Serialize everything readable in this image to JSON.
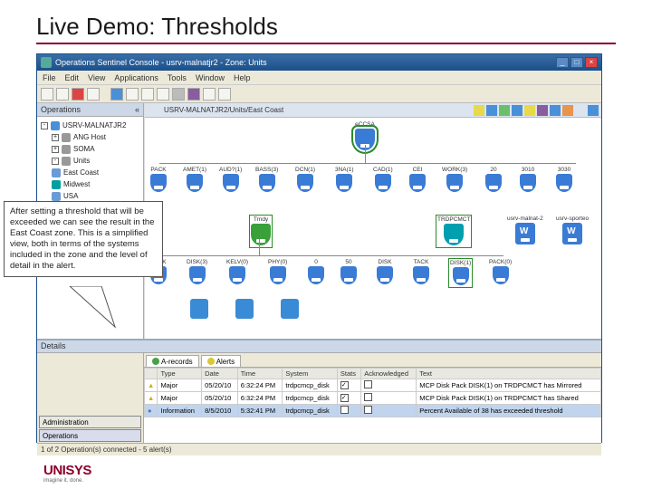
{
  "slide": {
    "title": "Live Demo: Thresholds"
  },
  "callout_text": "After setting a threshold that will be exceeded we can see the result in the East Coast zone.  This is a simplified view, both in terms of the systems included in the zone and the level of detail in the alert.",
  "window": {
    "title": "Operations Sentinel Console - usrv-malnatjr2 - Zone: Units",
    "menu": [
      "File",
      "Edit",
      "View",
      "Applications",
      "Tools",
      "Window",
      "Help"
    ]
  },
  "left_panel": {
    "title": "Operations"
  },
  "tree": [
    {
      "label": "USRV-MALNATJR2",
      "depth": 0,
      "icon": "host",
      "sq": "-"
    },
    {
      "label": "ANG Host",
      "depth": 1,
      "icon": "grp",
      "sq": "+"
    },
    {
      "label": "SOMA",
      "depth": 1,
      "icon": "grp",
      "sq": "+"
    },
    {
      "label": "Units",
      "depth": 1,
      "icon": "grp",
      "sq": "-"
    },
    {
      "label": "East Coast",
      "depth": 1,
      "icon": "globe",
      "sq": ""
    },
    {
      "label": "Midwest",
      "depth": 1,
      "icon": "mach",
      "sq": ""
    },
    {
      "label": "USA",
      "depth": 1,
      "icon": "globe",
      "sq": ""
    }
  ],
  "crumb": "USRV-MALNATJR2/Units/East Coast",
  "top_nodes": {
    "root": "eCCSA",
    "row": [
      "PACK",
      "AMET(1)",
      "AUD?(1)",
      "BASS(3)",
      "DCN(1)",
      "3NA(1)",
      "CAD(1)",
      "CEI",
      "WORK(3)",
      "20",
      "3010",
      "3030"
    ]
  },
  "mid_nodes": {
    "left": "Trndy",
    "right_group": [
      "TRDPCMCT",
      "usrv-malnat-2",
      "usrv-sporteo"
    ]
  },
  "low_nodes": [
    "PACK",
    "DISK(3)",
    "KELV(0)",
    "PHY(0)",
    "0",
    "50",
    "DISK",
    "TACK",
    "DISK(1)",
    "PACK(0)"
  ],
  "details_title": "Details",
  "tabs": [
    "A-records",
    "Alerts"
  ],
  "table": {
    "columns": [
      "",
      "Type",
      "Date",
      "Time",
      "System",
      "Stats",
      "Acknowledged",
      "Text"
    ],
    "rows": [
      [
        "y",
        "Major",
        "05/20/10",
        "6:32:24 PM",
        "trdpcmcp_disk",
        "ck",
        "",
        "MCP Disk Pack DISK(1) on TRDPCMCT has Mirrored"
      ],
      [
        "y",
        "Major",
        "05/20/10",
        "6:32:24 PM",
        "trdpcmcp_disk",
        "ck",
        "",
        "MCP Disk Pack DISK(1) on TRDPCMCT has Shared"
      ],
      [
        "hl",
        "Information",
        "8/5/2010",
        "5:32:41 PM",
        "trdpcmcp_disk",
        "",
        "",
        "Percent Available of 38 has exceeded threshold"
      ]
    ]
  },
  "mode_buttons": [
    "Administration",
    "Operations"
  ],
  "status_text": "1 of 2 Operation(s) connected - 5 alert(s)",
  "logo": {
    "brand": "UNISYS",
    "tag": "imagine it. done."
  }
}
